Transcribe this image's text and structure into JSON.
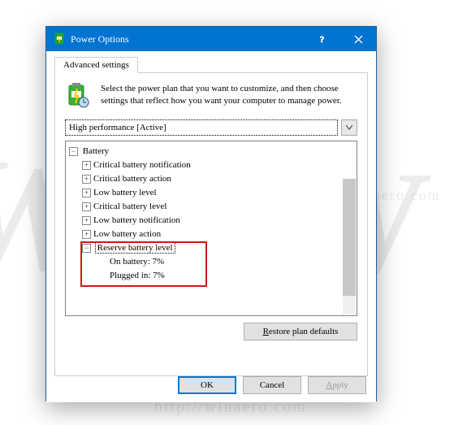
{
  "window": {
    "title": "Power Options"
  },
  "tab": {
    "label": "Advanced settings"
  },
  "intro": {
    "text": "Select the power plan that you want to customize, and then choose settings that reflect how you want your computer to manage power."
  },
  "plan": {
    "selected": "High performance [Active]"
  },
  "tree": {
    "root": "Battery",
    "items": [
      "Critical battery notification",
      "Critical battery action",
      "Low battery level",
      "Critical battery level",
      "Low battery notification",
      "Low battery action"
    ],
    "reserve": {
      "label": "Reserve battery level",
      "on_battery_label": "On battery:",
      "on_battery_value": "7%",
      "plugged_in_label": "Plugged in:",
      "plugged_in_value": "7%"
    }
  },
  "buttons": {
    "restore": "Restore plan defaults",
    "ok": "OK",
    "cancel": "Cancel",
    "apply": "Apply"
  },
  "watermark": {
    "w": "W",
    "url_top": "http://winaero.com",
    "url_bot": "http://winaero.com"
  }
}
